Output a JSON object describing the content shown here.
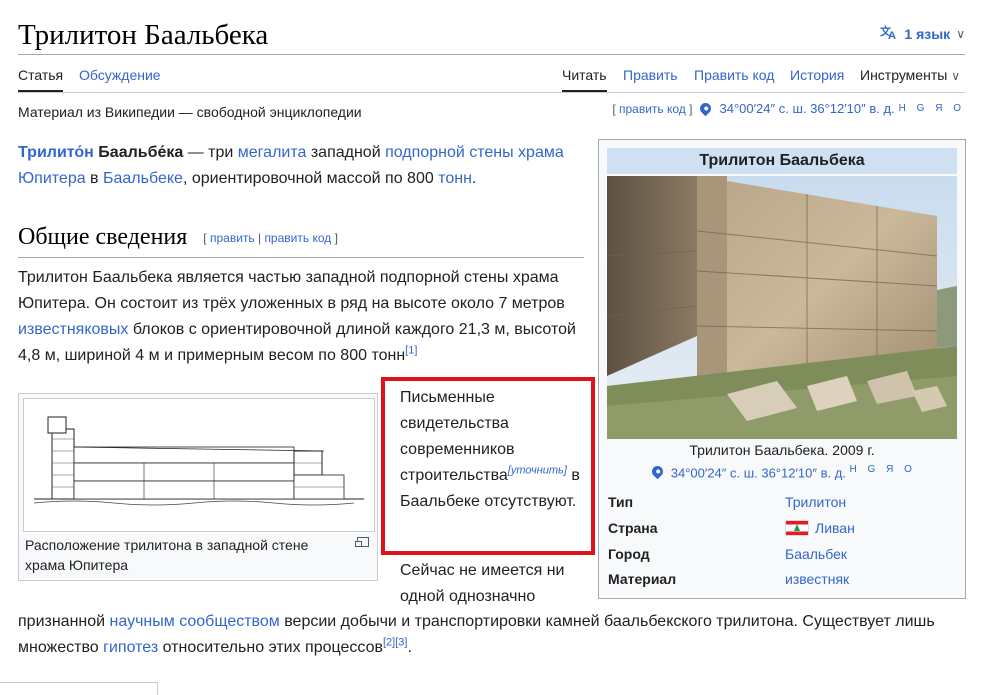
{
  "header": {
    "title": "Трилитон Баальбека",
    "lang_button": "1 язык"
  },
  "tabs": {
    "left": [
      "Статья",
      "Обсуждение"
    ],
    "right": [
      "Читать",
      "Править",
      "Править код",
      "История",
      "Инструменты"
    ]
  },
  "tagline": "Материал из Википедии — свободной энциклопедии",
  "top_edit": "править код",
  "coords": {
    "text": "34°00′24″ с. ш. 36°12′10″ в. д.",
    "links": "H G Я O"
  },
  "intro": {
    "bold1": "Трилито́н",
    "bold2": "Баальбе́ка",
    "t1": " — три ",
    "l1": "мегалита",
    "t2": " западной ",
    "l2": "подпорной стены храма Юпитера",
    "t3": " в ",
    "l3": "Баальбеке",
    "t4": ", ориентировочной массой по 800 ",
    "l4": "тонн",
    "t5": "."
  },
  "section": {
    "heading": "Общие сведения",
    "edit": "править",
    "edit_code": "править код",
    "sep": " | "
  },
  "para2": {
    "t1": "Трилитон Баальбека является частью западной подпорной стены храма Юпитера. Он состоит из трёх уложенных в ряд на высоте около 7 метров ",
    "l1": "известняковых",
    "t2": " блоков с ориентировочной длиной каждого 21,3 м, высотой 4,8 м, шириной 4 м и примерным весом по 800 тонн",
    "ref": "[1]"
  },
  "figure": {
    "caption": "Расположение трилитона в западной стене храма Юпитера"
  },
  "highlight": {
    "text1": "Письменные свидетельства современников строительства",
    "clarify": "[уточнить]",
    "text2": "в Баальбеке отсутствуют."
  },
  "para3": {
    "t1": "Сейчас не имеется ни одной однозначно",
    "t2": "признанной ",
    "l1": "научным сообществом",
    "t3": " версии добычи и транспортировки камней баальбекского трилитона. Существует лишь множество ",
    "l2": "гипотез",
    "t4": " относительно этих процессов",
    "ref1": "[2]",
    "ref2": "[3]",
    "t5": "."
  },
  "infobox": {
    "title": "Трилитон Баальбека",
    "caption": "Трилитон Баальбека. 2009 г.",
    "coords": "34°00′24″ с. ш. 36°12′10″ в. д.",
    "coord_links": "H G Я O",
    "rows": [
      {
        "label": "Тип",
        "value": "Трилитон"
      },
      {
        "label": "Страна",
        "value": "Ливан"
      },
      {
        "label": "Город",
        "value": "Баальбек"
      },
      {
        "label": "Материал",
        "value": "известняк"
      }
    ]
  }
}
